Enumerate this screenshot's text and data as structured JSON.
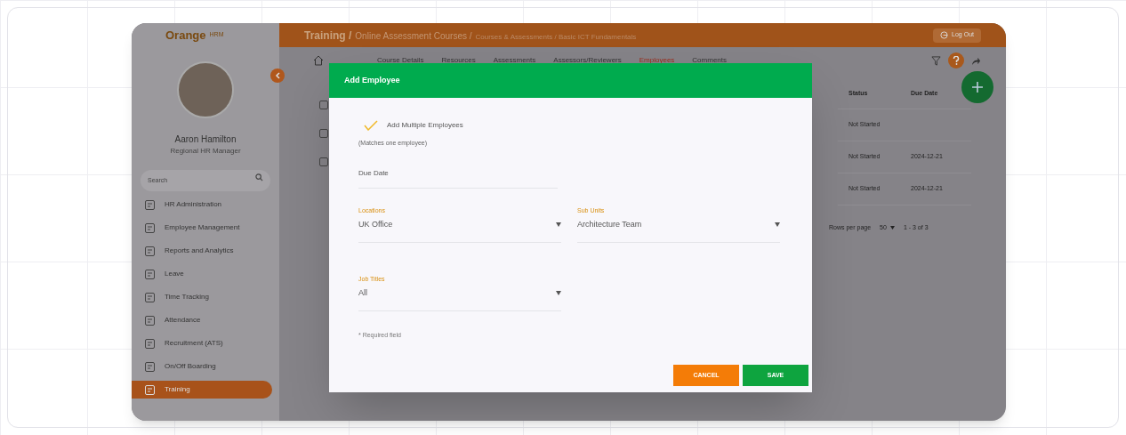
{
  "logo": {
    "brand": "Orange",
    "suffix": "HRM"
  },
  "breadcrumb": [
    {
      "text": "Training /",
      "kind": "strong"
    },
    {
      "text": "Online Assessment Courses /",
      "kind": "mid"
    },
    {
      "text": "Courses & Assessments / Basic ICT Fundamentals",
      "kind": "light"
    }
  ],
  "logout": "Log Out",
  "user": {
    "name": "Aaron Hamilton",
    "role": "Regional HR Manager"
  },
  "sidebar": {
    "search_placeholder": "Search",
    "items": [
      {
        "label": "HR Administration",
        "selected": false
      },
      {
        "label": "Employee Management",
        "selected": false
      },
      {
        "label": "Reports and Analytics",
        "selected": false
      },
      {
        "label": "Leave",
        "selected": false
      },
      {
        "label": "Time Tracking",
        "selected": false
      },
      {
        "label": "Attendance",
        "selected": false
      },
      {
        "label": "Recruitment (ATS)",
        "selected": false
      },
      {
        "label": "On/Off Boarding",
        "selected": false
      },
      {
        "label": "Training",
        "selected": true
      }
    ]
  },
  "tabs": [
    {
      "label": "Course Details",
      "selected": false
    },
    {
      "label": "Resources",
      "selected": false
    },
    {
      "label": "Assessments",
      "selected": false
    },
    {
      "label": "Assessors/Reviewers",
      "selected": false
    },
    {
      "label": "Employees",
      "selected": true
    },
    {
      "label": "Comments",
      "selected": false
    }
  ],
  "table": {
    "columns": [
      "Status",
      "Due Date"
    ],
    "rows": [
      {
        "checked": false,
        "cells": [
          "Not Started",
          ""
        ]
      },
      {
        "checked": false,
        "cells": [
          "Not Started",
          "2024-12-21"
        ]
      },
      {
        "checked": false,
        "cells": [
          "Not Started",
          "2024-12-21"
        ]
      }
    ],
    "rows_per_page_label": "Rows per page",
    "rows_per_page": "50",
    "range": "1 - 3 of 3"
  },
  "dialog": {
    "title": "Add Employee",
    "multiple": {
      "label": "Add Multiple Employees",
      "checked": true
    },
    "matches": "(Matches one employee)",
    "due_date": {
      "placeholder": "Due Date"
    },
    "fields": [
      {
        "label": "Locations",
        "value": "UK Office"
      },
      {
        "label": "Sub Units",
        "value": "Architecture Team"
      },
      {
        "label": "Job Titles",
        "value": "All"
      }
    ],
    "required_note": "* Required field",
    "buttons": [
      {
        "label": "CANCEL",
        "kind": "cancel"
      },
      {
        "label": "SAVE",
        "kind": "save"
      }
    ]
  }
}
